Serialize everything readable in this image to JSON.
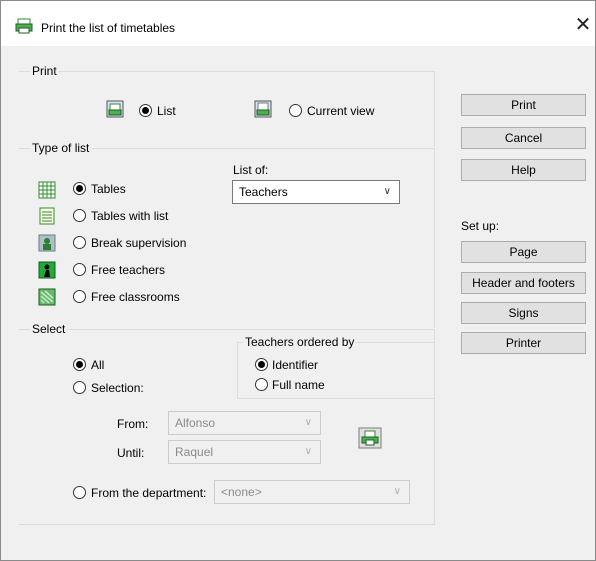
{
  "window": {
    "title": "Print the list of timetables",
    "close_glyph": "✕"
  },
  "print_group": {
    "label": "Print",
    "options": [
      {
        "label": "List",
        "checked": true,
        "icon": "print-list-icon"
      },
      {
        "label": "Current view",
        "checked": false,
        "icon": "print-view-icon"
      }
    ]
  },
  "type_of_list": {
    "label": "Type of list",
    "options": [
      {
        "label": "Tables",
        "checked": true,
        "icon": "grid-table-icon"
      },
      {
        "label": "Tables with list",
        "checked": false,
        "icon": "table-list-icon"
      },
      {
        "label": "Break supervision",
        "checked": false,
        "icon": "supervision-icon"
      },
      {
        "label": "Free teachers",
        "checked": false,
        "icon": "free-teacher-icon"
      },
      {
        "label": "Free classrooms",
        "checked": false,
        "icon": "free-classroom-icon"
      }
    ],
    "list_of_label": "List of:",
    "list_of_value": "Teachers"
  },
  "select_group": {
    "label": "Select",
    "options": [
      {
        "label": "All",
        "checked": true
      },
      {
        "label": "Selection:",
        "checked": false
      }
    ],
    "from_label": "From:",
    "from_value": "Alfonso",
    "until_label": "Until:",
    "until_value": "Raquel",
    "department_label": "From the department:",
    "department_value": "<none>",
    "department_checked": false
  },
  "ordered_by": {
    "label": "Teachers ordered by",
    "options": [
      {
        "label": "Identifier",
        "checked": true
      },
      {
        "label": "Full name",
        "checked": false
      }
    ]
  },
  "buttons": {
    "print": "Print",
    "cancel": "Cancel",
    "help": "Help"
  },
  "setup": {
    "label": "Set up:",
    "page": "Page",
    "header_footers": "Header and footers",
    "signs": "Signs",
    "printer": "Printer"
  },
  "colors": {
    "accent_green": "#2e8b2e",
    "icon_blue": "#3a6ea5"
  }
}
